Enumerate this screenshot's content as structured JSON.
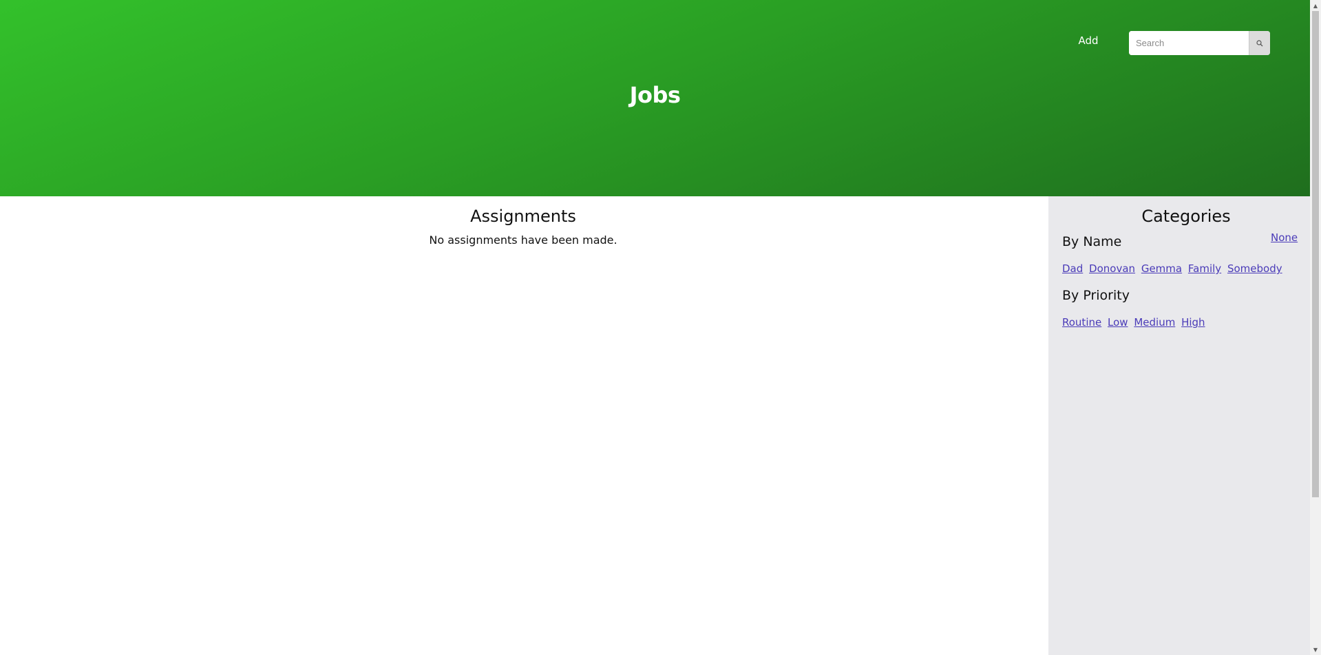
{
  "header": {
    "title": "Jobs",
    "add_label": "Add",
    "search": {
      "placeholder": "Search",
      "value": "",
      "icon": "search-icon"
    }
  },
  "main": {
    "heading": "Assignments",
    "empty_message": "No assignments have been made."
  },
  "sidebar": {
    "heading": "Categories",
    "none_label": "None",
    "by_name": {
      "heading": "By Name",
      "items": [
        "Dad",
        "Donovan",
        "Gemma",
        "Family",
        "Somebody"
      ]
    },
    "by_priority": {
      "heading": "By Priority",
      "items": [
        "Routine",
        "Low",
        "Medium",
        "High"
      ]
    }
  },
  "colors": {
    "header_gradient_start": "#33c12b",
    "header_gradient_end": "#1f6e1e",
    "sidebar_bg": "#e9e9ec",
    "link": "#4a3bb8"
  }
}
